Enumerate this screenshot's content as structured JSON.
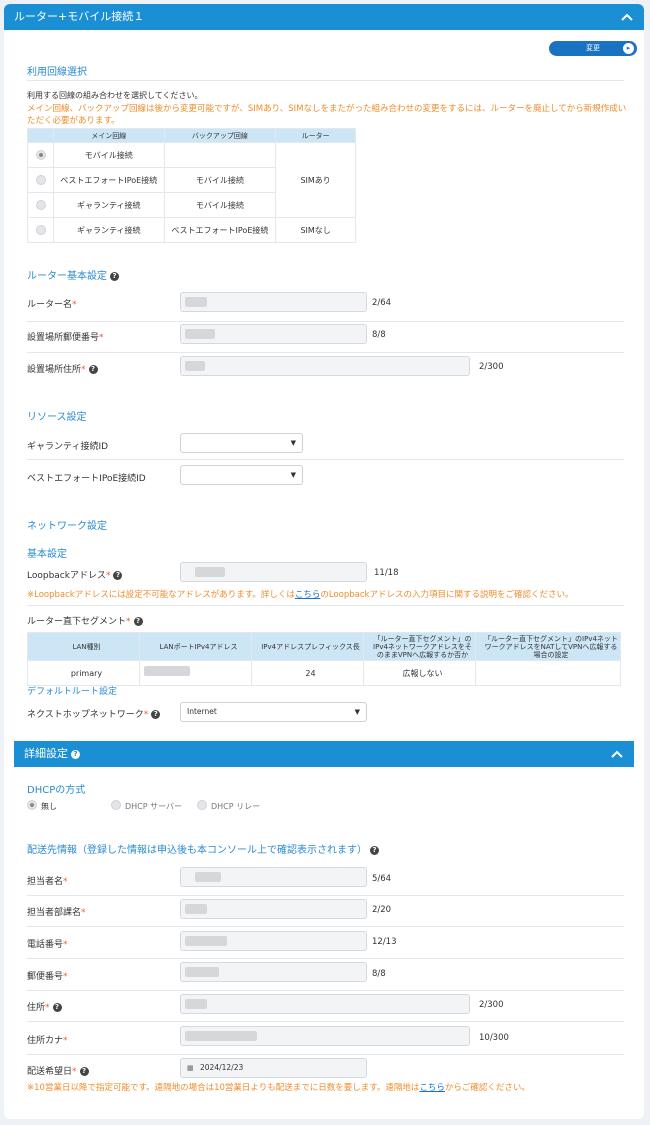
{
  "header1": {
    "title": "ルーター+モバイル接続１"
  },
  "change_button": {
    "label": "変更"
  },
  "line_select": {
    "section_title": "利用回線選択",
    "description": "利用する回線の組み合わせを選択してください。",
    "note": "メイン回線、バックアップ回線は後から変更可能ですが、SIMあり、SIMなしをまたがった組み合わせの変更をするには、ルーターを廃止してから新規作成いただく必要があります。",
    "columns": [
      "メイン回線",
      "バックアップ回線",
      "ルーター"
    ],
    "rows": [
      {
        "main": "モバイル接続",
        "backup": "",
        "selected": true
      },
      {
        "main": "ベストエフォートIPoE接続",
        "backup": "モバイル接続",
        "selected": false
      },
      {
        "main": "ギャランティ接続",
        "backup": "モバイル接続",
        "selected": false
      },
      {
        "main": "ギャランティ接続",
        "backup": "ベストエフォートIPoE接続",
        "selected": false
      }
    ],
    "router_sim": "SIMあり",
    "router_nosim": "SIMなし"
  },
  "router_basic": {
    "section_title": "ルーター基本設定",
    "name_label": "ルーター名",
    "name_count": "2/64",
    "zip_label": "設置場所郵便番号",
    "zip_count": "8/8",
    "addr_label": "設置場所住所",
    "addr_count": "2/300"
  },
  "resource": {
    "section_title": "リソース設定",
    "guarantee_label": "ギャランティ接続ID",
    "besteffort_label": "ベストエフォートIPoE接続ID"
  },
  "network": {
    "section_title": "ネットワーク設定",
    "basic_title": "基本設定",
    "loopback_label": "Loopbackアドレス",
    "loopback_count": "11/18",
    "loopback_note_pre": "※Loopbackアドレスには設定不可能なアドレスがあります。詳しくは",
    "loopback_note_link": "こちら",
    "loopback_note_post": "のLoopbackアドレスの入力項目に関する説明をご確認ください。",
    "segment_label": "ルーター直下セグメント",
    "segment_columns": [
      "LAN種別",
      "LANポートIPv4アドレス",
      "IPv4アドレスプレフィックス長",
      "「ルーター直下セグメント」のIPv4ネットワークアドレスをそのままVPNへ広報するか否か",
      "「ルーター直下セグメント」のIPv4ネットワークアドレスをNATしてVPNへ広報する場合の設定"
    ],
    "segment_row": {
      "type": "primary",
      "prefix": "24",
      "advertise": "広報しない"
    },
    "default_route_title": "デフォルトルート設定",
    "nexthop_label": "ネクストホップネットワーク",
    "nexthop_value": "Internet"
  },
  "header2": {
    "title": "詳細設定"
  },
  "dhcp": {
    "section_title": "DHCPの方式",
    "options": [
      "無し",
      "DHCP サーバー",
      "DHCP リレー"
    ]
  },
  "delivery": {
    "section_title": "配送先情報（登録した情報は申込後も本コンソール上で確認表示されます）",
    "person_label": "担当者名",
    "person_count": "5/64",
    "dept_label": "担当者部課名",
    "dept_count": "2/20",
    "phone_label": "電話番号",
    "phone_count": "12/13",
    "zip_label": "郵便番号",
    "zip_count": "8/8",
    "addr_label": "住所",
    "addr_count": "2/300",
    "kana_label": "住所カナ",
    "kana_count": "10/300",
    "date_label": "配送希望日",
    "date_value": "2024/12/23",
    "note_pre": "※10営業日以降で指定可能です。遠隔地の場合は10営業日よりも配送までに日数を要します。遠隔地は",
    "note_link": "こちら",
    "note_post": "からご確認ください。"
  },
  "colors": {
    "accent": "#1a8fd4",
    "note": "#f08c2a",
    "required": "#e85b3a"
  }
}
